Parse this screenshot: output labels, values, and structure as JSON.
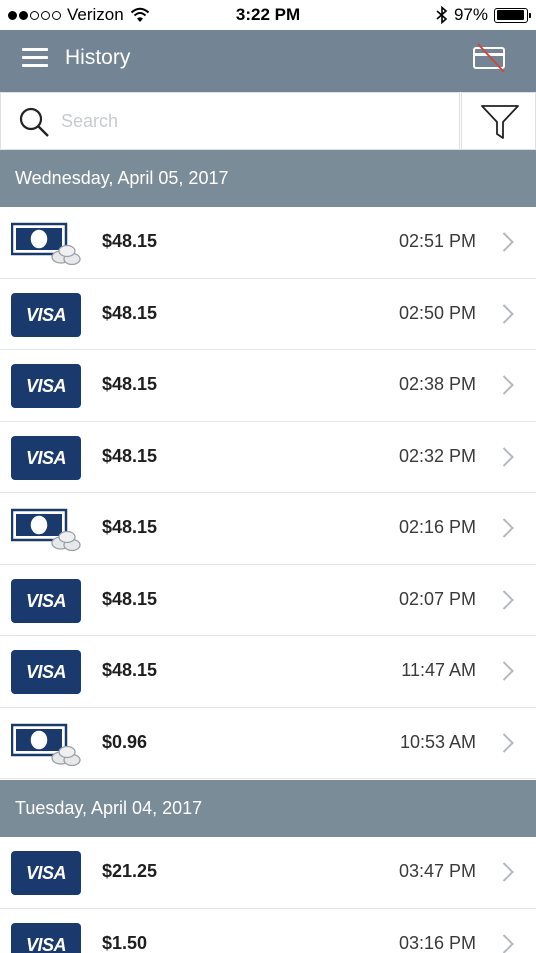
{
  "status_bar": {
    "carrier": "Verizon",
    "time": "3:22 PM",
    "battery": "97%",
    "battery_level": 0.97,
    "signal_bars_filled": 2,
    "signal_bars_total": 5
  },
  "header": {
    "title": "History",
    "menu_icon": "hamburger-menu-icon",
    "right_icon": "card-crossed-icon"
  },
  "search": {
    "placeholder": "Search",
    "value": ""
  },
  "colors": {
    "navbar": "#738594",
    "section_header": "#7b8c99",
    "visa_blue": "#1a3a6e"
  },
  "sections": [
    {
      "date": "Wednesday, April 05, 2017",
      "rows": [
        {
          "method": "cash",
          "amount": "$48.15",
          "time": "02:51 PM"
        },
        {
          "method": "visa",
          "label": "VISA",
          "amount": "$48.15",
          "time": "02:50 PM"
        },
        {
          "method": "visa",
          "label": "VISA",
          "amount": "$48.15",
          "time": "02:38 PM"
        },
        {
          "method": "visa",
          "label": "VISA",
          "amount": "$48.15",
          "time": "02:32 PM"
        },
        {
          "method": "cash",
          "amount": "$48.15",
          "time": "02:16 PM"
        },
        {
          "method": "visa",
          "label": "VISA",
          "amount": "$48.15",
          "time": "02:07 PM"
        },
        {
          "method": "visa",
          "label": "VISA",
          "amount": "$48.15",
          "time": "11:47 AM"
        },
        {
          "method": "cash",
          "amount": "$0.96",
          "time": "10:53 AM"
        }
      ]
    },
    {
      "date": "Tuesday, April 04, 2017",
      "rows": [
        {
          "method": "visa",
          "label": "VISA",
          "amount": "$21.25",
          "time": "03:47 PM"
        },
        {
          "method": "visa",
          "label": "VISA",
          "amount": "$1.50",
          "time": "03:16 PM"
        }
      ]
    }
  ]
}
